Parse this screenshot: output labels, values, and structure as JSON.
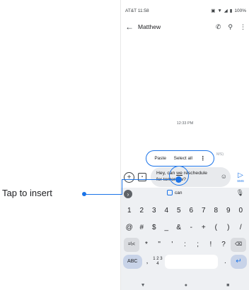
{
  "status": {
    "carrier_time": "AT&T 11:58",
    "battery": "100%"
  },
  "appbar": {
    "back_icon": "arrow-back-icon",
    "contact_name": "Matthew",
    "call_icon": "phone-icon",
    "search_icon": "search-icon",
    "more_icon": "more-vert-icon"
  },
  "conversation": {
    "timestamp": "12:33 PM"
  },
  "context_menu": {
    "paste": "Paste",
    "select_all": "Select all",
    "more": "⋮",
    "mms_hint": "MS)"
  },
  "compose": {
    "text_before": "Hey, can ",
    "text_underlined": "we",
    "text_after": " reschedule",
    "text_line2": "for tomorrow?",
    "send_label": "SMS"
  },
  "keyboard": {
    "suggestion": "can",
    "row1": [
      "1",
      "2",
      "3",
      "4",
      "5",
      "6",
      "7",
      "8",
      "9",
      "0"
    ],
    "row2": [
      "@",
      "#",
      "$",
      "_",
      "&",
      "-",
      "+",
      "(",
      ")",
      "/"
    ],
    "row3": [
      "=\\<",
      "*",
      "\"",
      "'",
      ":",
      ";",
      "!",
      "?",
      "⌫"
    ],
    "row4": {
      "abc": "ABC",
      "comma": ",",
      "numpad": "1 2\n3 4",
      "period": ".",
      "enter": "↵"
    }
  },
  "callout": {
    "label": "Tap to insert"
  },
  "colors": {
    "accent": "#1a73e8",
    "keyboard_bg": "#eef0f3",
    "input_bg": "#e8eaed"
  }
}
